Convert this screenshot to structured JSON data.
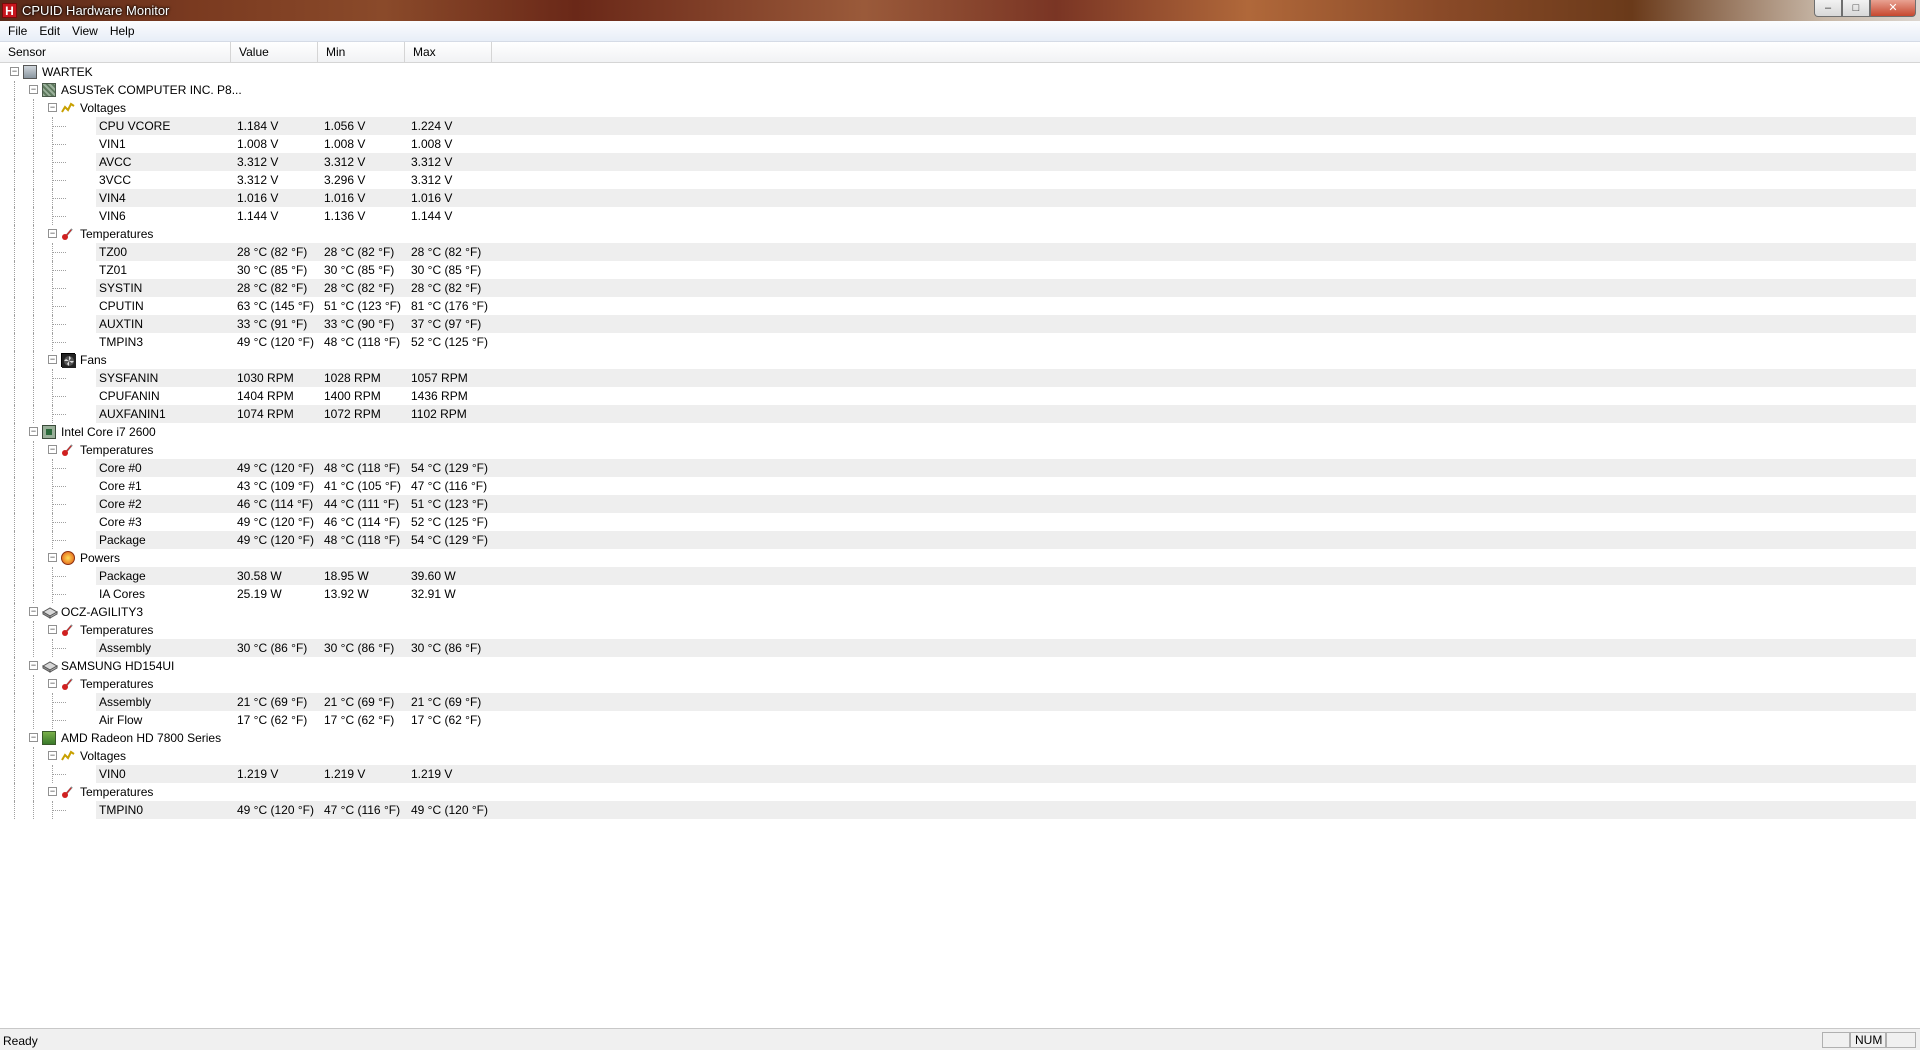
{
  "window": {
    "title": "CPUID Hardware Monitor",
    "app_icon_letter": "H",
    "minimize_glyph": "‒",
    "maximize_glyph": "□",
    "close_glyph": "✕"
  },
  "menu": {
    "items": [
      "File",
      "Edit",
      "View",
      "Help"
    ]
  },
  "columns": {
    "sensor": "Sensor",
    "value": "Value",
    "min": "Min",
    "max": "Max"
  },
  "tree": [
    {
      "level": 0,
      "icon": "computer-icon",
      "label": "WARTEK",
      "expanded": true
    },
    {
      "level": 1,
      "icon": "motherboard-icon",
      "label": "ASUSTeK COMPUTER INC. P8...",
      "expanded": true
    },
    {
      "level": 2,
      "icon": "voltage-icon",
      "label": "Voltages",
      "expanded": true
    },
    {
      "level": 3,
      "label": "CPU VCORE",
      "value": "1.184 V",
      "min": "1.056 V",
      "max": "1.224 V"
    },
    {
      "level": 3,
      "label": "VIN1",
      "value": "1.008 V",
      "min": "1.008 V",
      "max": "1.008 V"
    },
    {
      "level": 3,
      "label": "AVCC",
      "value": "3.312 V",
      "min": "3.312 V",
      "max": "3.312 V"
    },
    {
      "level": 3,
      "label": "3VCC",
      "value": "3.312 V",
      "min": "3.296 V",
      "max": "3.312 V"
    },
    {
      "level": 3,
      "label": "VIN4",
      "value": "1.016 V",
      "min": "1.016 V",
      "max": "1.016 V"
    },
    {
      "level": 3,
      "label": "VIN6",
      "value": "1.144 V",
      "min": "1.136 V",
      "max": "1.144 V"
    },
    {
      "level": 2,
      "icon": "thermometer-icon",
      "label": "Temperatures",
      "expanded": true
    },
    {
      "level": 3,
      "label": "TZ00",
      "value": "28 °C  (82 °F)",
      "min": "28 °C  (82 °F)",
      "max": "28 °C  (82 °F)"
    },
    {
      "level": 3,
      "label": "TZ01",
      "value": "30 °C  (85 °F)",
      "min": "30 °C  (85 °F)",
      "max": "30 °C  (85 °F)"
    },
    {
      "level": 3,
      "label": "SYSTIN",
      "value": "28 °C  (82 °F)",
      "min": "28 °C  (82 °F)",
      "max": "28 °C  (82 °F)"
    },
    {
      "level": 3,
      "label": "CPUTIN",
      "value": "63 °C  (145 °F)",
      "min": "51 °C  (123 °F)",
      "max": "81 °C  (176 °F)"
    },
    {
      "level": 3,
      "label": "AUXTIN",
      "value": "33 °C  (91 °F)",
      "min": "33 °C  (90 °F)",
      "max": "37 °C  (97 °F)"
    },
    {
      "level": 3,
      "label": "TMPIN3",
      "value": "49 °C  (120 °F)",
      "min": "48 °C  (118 °F)",
      "max": "52 °C  (125 °F)"
    },
    {
      "level": 2,
      "icon": "fan-icon",
      "label": "Fans",
      "expanded": true
    },
    {
      "level": 3,
      "label": "SYSFANIN",
      "value": "1030 RPM",
      "min": "1028 RPM",
      "max": "1057 RPM"
    },
    {
      "level": 3,
      "label": "CPUFANIN",
      "value": "1404 RPM",
      "min": "1400 RPM",
      "max": "1436 RPM"
    },
    {
      "level": 3,
      "label": "AUXFANIN1",
      "value": "1074 RPM",
      "min": "1072 RPM",
      "max": "1102 RPM"
    },
    {
      "level": 1,
      "icon": "cpu-icon",
      "label": "Intel Core i7 2600",
      "expanded": true
    },
    {
      "level": 2,
      "icon": "thermometer-icon",
      "label": "Temperatures",
      "expanded": true
    },
    {
      "level": 3,
      "label": "Core #0",
      "value": "49 °C  (120 °F)",
      "min": "48 °C  (118 °F)",
      "max": "54 °C  (129 °F)"
    },
    {
      "level": 3,
      "label": "Core #1",
      "value": "43 °C  (109 °F)",
      "min": "41 °C  (105 °F)",
      "max": "47 °C  (116 °F)"
    },
    {
      "level": 3,
      "label": "Core #2",
      "value": "46 °C  (114 °F)",
      "min": "44 °C  (111 °F)",
      "max": "51 °C  (123 °F)"
    },
    {
      "level": 3,
      "label": "Core #3",
      "value": "49 °C  (120 °F)",
      "min": "46 °C  (114 °F)",
      "max": "52 °C  (125 °F)"
    },
    {
      "level": 3,
      "label": "Package",
      "value": "49 °C  (120 °F)",
      "min": "48 °C  (118 °F)",
      "max": "54 °C  (129 °F)"
    },
    {
      "level": 2,
      "icon": "power-icon",
      "label": "Powers",
      "expanded": true
    },
    {
      "level": 3,
      "label": "Package",
      "value": "30.58 W",
      "min": "18.95 W",
      "max": "39.60 W"
    },
    {
      "level": 3,
      "label": "IA Cores",
      "value": "25.19 W",
      "min": "13.92 W",
      "max": "32.91 W"
    },
    {
      "level": 1,
      "icon": "disk-icon",
      "label": "OCZ-AGILITY3",
      "expanded": true
    },
    {
      "level": 2,
      "icon": "thermometer-icon",
      "label": "Temperatures",
      "expanded": true
    },
    {
      "level": 3,
      "label": "Assembly",
      "value": "30 °C  (86 °F)",
      "min": "30 °C  (86 °F)",
      "max": "30 °C  (86 °F)"
    },
    {
      "level": 1,
      "icon": "disk-icon",
      "label": "SAMSUNG HD154UI",
      "expanded": true
    },
    {
      "level": 2,
      "icon": "thermometer-icon",
      "label": "Temperatures",
      "expanded": true
    },
    {
      "level": 3,
      "label": "Assembly",
      "value": "21 °C  (69 °F)",
      "min": "21 °C  (69 °F)",
      "max": "21 °C  (69 °F)"
    },
    {
      "level": 3,
      "label": "Air Flow",
      "value": "17 °C  (62 °F)",
      "min": "17 °C  (62 °F)",
      "max": "17 °C  (62 °F)"
    },
    {
      "level": 1,
      "icon": "gpu-icon",
      "label": "AMD Radeon HD 7800 Series",
      "expanded": true
    },
    {
      "level": 2,
      "icon": "voltage-icon",
      "label": "Voltages",
      "expanded": true
    },
    {
      "level": 3,
      "label": "VIN0",
      "value": "1.219 V",
      "min": "1.219 V",
      "max": "1.219 V"
    },
    {
      "level": 2,
      "icon": "thermometer-icon",
      "label": "Temperatures",
      "expanded": true
    },
    {
      "level": 3,
      "label": "TMPIN0",
      "value": "49 °C  (120 °F)",
      "min": "47 °C  (116 °F)",
      "max": "49 °C  (120 °F)"
    }
  ],
  "statusbar": {
    "text": "Ready",
    "num": "NUM"
  },
  "colors": {
    "alt_row": "#eeeeee",
    "voltage_icon": "#c8a000",
    "thermometer_icon": "#d02020"
  }
}
